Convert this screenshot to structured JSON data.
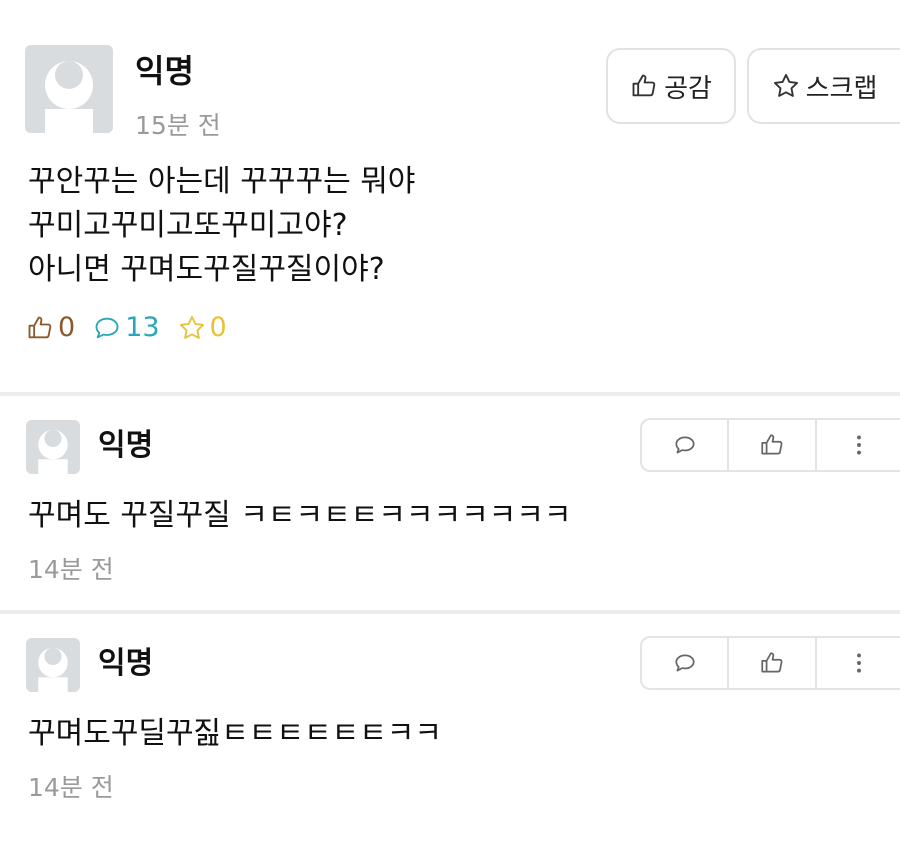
{
  "post": {
    "author": "익명",
    "time": "15분 전",
    "like_button": "공감",
    "scrap_button": "스크랩",
    "body_lines": [
      "꾸안꾸는 아는데 꾸꾸꾸는 뭐야",
      "꾸미고꾸미고또꾸미고야?",
      "아니면 꾸며도꾸질꾸질이야?"
    ],
    "stats": {
      "likes": "0",
      "comments": "13",
      "scraps": "0"
    },
    "colors": {
      "like": "#8a5a2c",
      "comment": "#2aa6b8",
      "scrap": "#e8c23a"
    }
  },
  "comments": [
    {
      "author": "익명",
      "text": "꾸며도 꾸질꾸질 ㅋㅌㅋㅌㅌㅋㅋㅋㅋㅋㅋㅋ",
      "time": "14분 전"
    },
    {
      "author": "익명",
      "text": "꾸며도꾸딜꾸짎ㅌㅌㅌㅌㅌㅌㅋㅋ",
      "time": "14분 전"
    }
  ],
  "icons": {
    "like": "thumbs-up-icon",
    "scrap": "star-icon",
    "comment": "speech-bubble-icon",
    "more": "vertical-ellipsis-icon"
  }
}
